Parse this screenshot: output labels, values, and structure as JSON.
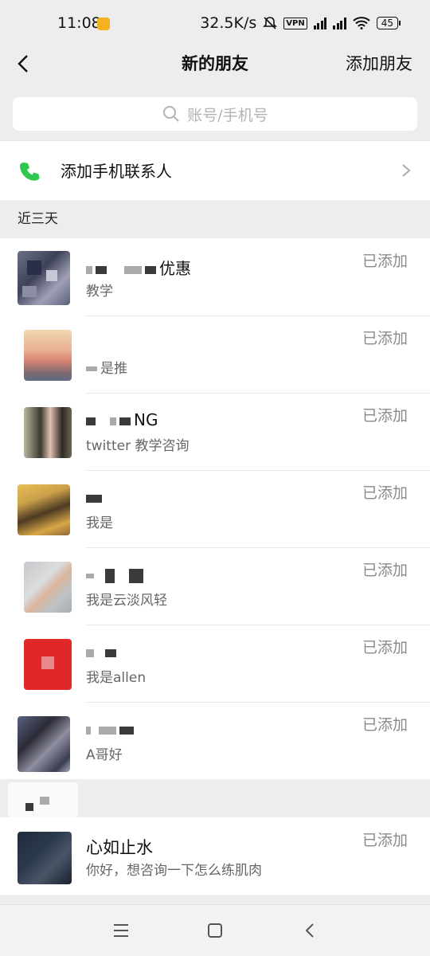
{
  "status_bar": {
    "time": "11:08",
    "network_speed": "32.5K/s",
    "vpn": "VPN",
    "battery": "45"
  },
  "header": {
    "title": "新的朋友",
    "action": "添加朋友"
  },
  "search": {
    "placeholder": "账号/手机号"
  },
  "phone_contacts": {
    "label": "添加手机联系人"
  },
  "sections": [
    {
      "label": "近三天"
    }
  ],
  "friends": [
    {
      "name": "优惠",
      "note": "教学",
      "status": "已添加"
    },
    {
      "name": "",
      "note": "是推",
      "status": "已添加"
    },
    {
      "name": "NG",
      "note": "twitter 教学咨询",
      "status": "已添加"
    },
    {
      "name": "",
      "note": "我是",
      "status": "已添加"
    },
    {
      "name": "",
      "note": "我是云淡风轻",
      "status": "已添加"
    },
    {
      "name": "",
      "note": "我是allen",
      "status": "已添加"
    },
    {
      "name": "",
      "note": "A哥好",
      "status": "已添加"
    },
    {
      "name": "心如止水",
      "note": "你好，想咨询一下怎么练肌肉",
      "status": "已添加"
    }
  ],
  "colors": {
    "accent_green": "#2dc84d",
    "background": "#ededed",
    "status_text": "#8a8a8a"
  }
}
